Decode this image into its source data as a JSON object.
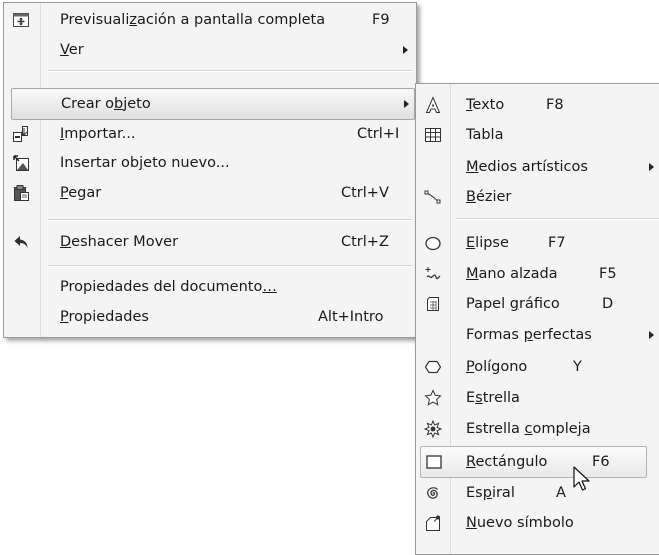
{
  "menu1": {
    "items": [
      {
        "pre": "Previsuali",
        "key": "z",
        "post": "ación a pantalla completa",
        "shortcut": "F9",
        "icon": "fullscreen-preview-icon"
      },
      {
        "pre": "",
        "key": "V",
        "post": "er",
        "shortcut": "",
        "icon": "",
        "submenu": true
      },
      {
        "pre": "Crear o",
        "key": "b",
        "post": "jeto",
        "shortcut": "",
        "icon": "",
        "submenu": true,
        "highlighted": true
      },
      {
        "pre": "",
        "key": "I",
        "post": "mportar...",
        "shortcut": "Ctrl+I",
        "icon": "import-icon"
      },
      {
        "pre": "Insertar objeto nuevo...",
        "key": "",
        "post": "",
        "shortcut": "",
        "icon": "insert-object-icon"
      },
      {
        "pre": "",
        "key": "P",
        "post": "egar",
        "shortcut": "Ctrl+V",
        "icon": "paste-icon"
      },
      {
        "pre": "",
        "key": "D",
        "post": "eshacer Mover",
        "shortcut": "Ctrl+Z",
        "icon": "undo-icon"
      },
      {
        "pre": "Propiedades del documento",
        "key": "…",
        "post": "",
        "shortcut": "",
        "icon": ""
      },
      {
        "pre": "",
        "key": "P",
        "post": "ropiedades",
        "shortcut": "Alt+Intro",
        "icon": ""
      }
    ]
  },
  "menu2": {
    "items": [
      {
        "pre": "",
        "key": "T",
        "post": "exto",
        "shortcut": "F8",
        "icon": "text-tool-icon"
      },
      {
        "pre": "Tabla",
        "key": "",
        "post": "",
        "shortcut": "",
        "icon": "table-icon"
      },
      {
        "pre": "",
        "key": "M",
        "post": "edios artísticos",
        "shortcut": "",
        "icon": "",
        "submenu": true
      },
      {
        "pre": "",
        "key": "B",
        "post": "ézier",
        "shortcut": "",
        "icon": "bezier-icon"
      },
      {
        "pre": "",
        "key": "E",
        "post": "lipse",
        "shortcut": "F7",
        "icon": "ellipse-icon"
      },
      {
        "pre": "",
        "key": "M",
        "post": "ano alzada",
        "shortcut": "F5",
        "icon": "freehand-icon"
      },
      {
        "pre": "Papel ",
        "key": "g",
        "post": "ráfico",
        "shortcut": "D",
        "icon": "graph-paper-icon"
      },
      {
        "pre": "Formas ",
        "key": "p",
        "post": "erfectas",
        "shortcut": "",
        "icon": "",
        "submenu": true
      },
      {
        "pre": "",
        "key": "P",
        "post": "olígono",
        "shortcut": "Y",
        "icon": "polygon-icon"
      },
      {
        "pre": "E",
        "key": "s",
        "post": "trella",
        "shortcut": "",
        "icon": "star-icon"
      },
      {
        "pre": "Estrella ",
        "key": "c",
        "post": "ompleja",
        "shortcut": "",
        "icon": "complex-star-icon"
      },
      {
        "pre": "",
        "key": "R",
        "post": "ectángulo",
        "shortcut": "F6",
        "icon": "rectangle-icon",
        "hovered": true
      },
      {
        "pre": "Es",
        "key": "p",
        "post": "iral",
        "shortcut": "A",
        "icon": "spiral-icon"
      },
      {
        "pre": "",
        "key": "N",
        "post": "uevo símbolo",
        "shortcut": "",
        "icon": "new-symbol-icon"
      }
    ]
  }
}
